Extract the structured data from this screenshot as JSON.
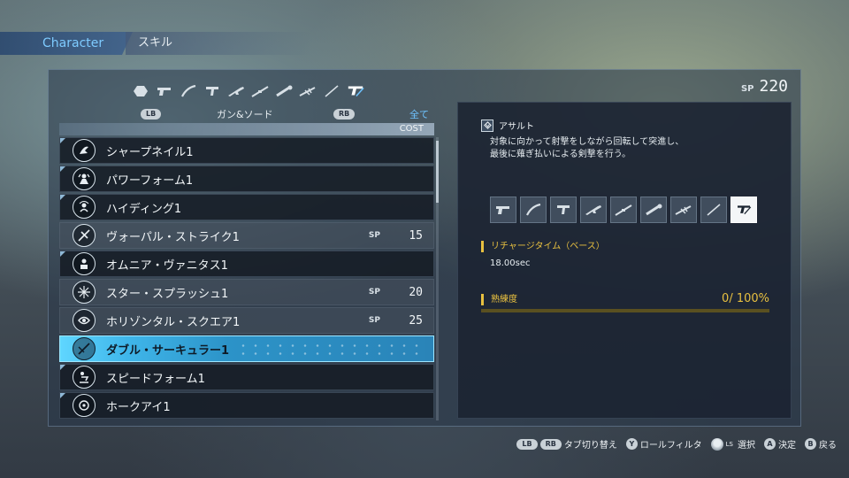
{
  "header": {
    "category": "Character",
    "page": "スキル"
  },
  "sp_total": {
    "label": "SP",
    "value": "220"
  },
  "weapon_filter": {
    "icons": [
      "hexagon-all-icon",
      "handgun-icon",
      "katana-icon",
      "twin-pistol-icon",
      "assault-rifle-icon",
      "rifle-icon",
      "launcher-icon",
      "gatling-icon",
      "sword-icon",
      "gun-and-sword-icon"
    ],
    "selected_index": 9,
    "lb": "LB",
    "rb": "RB",
    "category_label": "ガン&ソード",
    "filter_label": "全て"
  },
  "list": {
    "cost_header": "COST",
    "rows": [
      {
        "name": "シャープネイル1",
        "icon": "sharp-nail-icon",
        "sp": "",
        "cost": "",
        "state": "learned"
      },
      {
        "name": "パワーフォーム1",
        "icon": "power-form-icon",
        "sp": "",
        "cost": "",
        "state": "learned"
      },
      {
        "name": "ハイディング1",
        "icon": "hiding-icon",
        "sp": "",
        "cost": "",
        "state": "learned"
      },
      {
        "name": "ヴォーパル・ストライク1",
        "icon": "vorpal-strike-icon",
        "sp": "SP",
        "cost": "15",
        "state": "locked"
      },
      {
        "name": "オムニア・ヴァニタス1",
        "icon": "omnia-vanitas-icon",
        "sp": "",
        "cost": "",
        "state": "learned"
      },
      {
        "name": "スター・スプラッシュ1",
        "icon": "star-splash-icon",
        "sp": "SP",
        "cost": "20",
        "state": "locked"
      },
      {
        "name": "ホリゾンタル・スクエア1",
        "icon": "horizontal-square-icon",
        "sp": "SP",
        "cost": "25",
        "state": "locked"
      },
      {
        "name": "ダブル・サーキュラー1",
        "icon": "double-circular-icon",
        "sp": "",
        "cost": "",
        "state": "selected"
      },
      {
        "name": "スピードフォーム1",
        "icon": "speed-form-icon",
        "sp": "",
        "cost": "",
        "state": "learned"
      },
      {
        "name": "ホークアイ1",
        "icon": "hawk-eye-icon",
        "sp": "",
        "cost": "",
        "state": "learned"
      }
    ]
  },
  "detail": {
    "type_label": "アサルト",
    "description_line1": "対象に向かって射撃をしながら回転して突進し、",
    "description_line2": "最後に薙ぎ払いによる剣撃を行う。",
    "weapon_slots": [
      "handgun-icon",
      "katana-icon",
      "twin-pistol-icon",
      "assault-rifle-icon",
      "rifle-icon",
      "launcher-icon",
      "gatling-icon",
      "sword-icon",
      "gun-and-sword-icon"
    ],
    "active_slot_index": 8,
    "recharge_label": "リチャージタイム（ベース）",
    "recharge_value": "18.00sec",
    "proficiency_label": "熟練度",
    "proficiency_value": "0/ 100%",
    "proficiency_fraction": 0.0
  },
  "footer": {
    "lb": "LB",
    "rb": "RB",
    "tab_switch": "タブ切り替え",
    "y_button": "Y",
    "role_filter": "ロールフィルタ",
    "ls_sub": "LS",
    "select": "選択",
    "a_button": "A",
    "confirm": "決定",
    "b_button": "B",
    "back": "戻る"
  },
  "colors": {
    "accent": "#6ec3ff",
    "selected_row": "#3fb6ea",
    "stat_gold": "#e8c040"
  }
}
